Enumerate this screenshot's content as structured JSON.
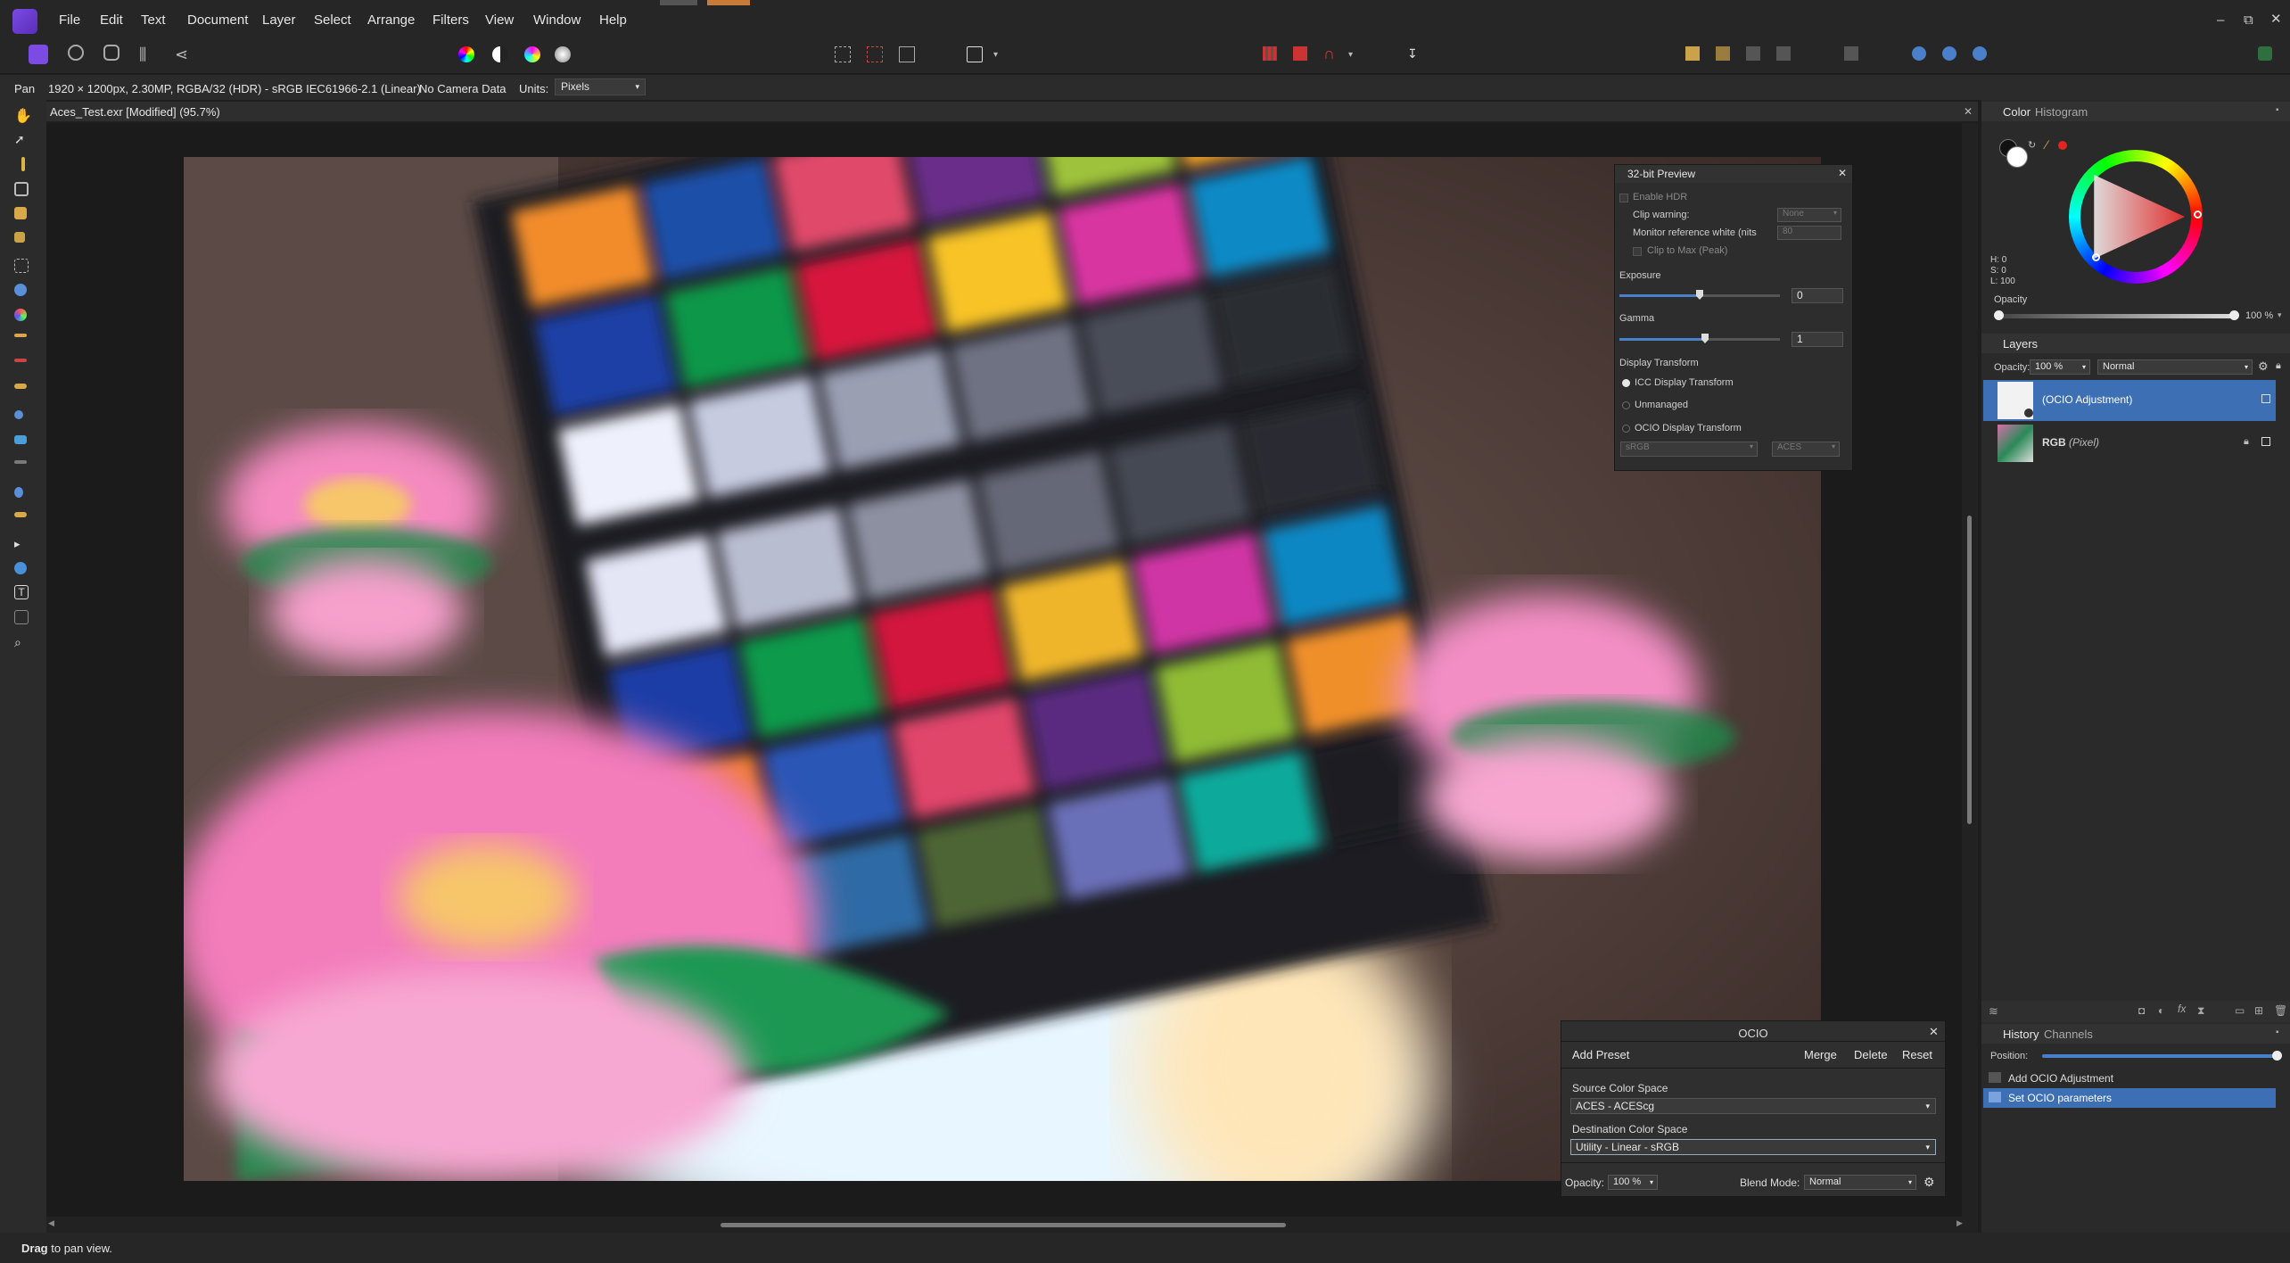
{
  "menu": {
    "items": [
      "File",
      "Edit",
      "Text",
      "Document",
      "Layer",
      "Select",
      "Arrange",
      "Filters",
      "View",
      "Window",
      "Help"
    ]
  },
  "context": {
    "tool": "Pan",
    "doc_info": "1920 × 1200px, 2.30MP, RGBA/32 (HDR) - sRGB IEC61966-2.1 (Linear)",
    "camera": "No Camera Data",
    "units_label": "Units:",
    "units_value": "Pixels"
  },
  "document": {
    "title": "Aces_Test.exr [Modified] (95.7%)"
  },
  "preview32": {
    "title": "32-bit Preview",
    "enable_hdr": "Enable HDR",
    "clip_warning": "Clip warning:",
    "clip_value": "None",
    "monitor_ref": "Monitor reference white (nits",
    "monitor_ref_value": "80",
    "clip_to_max": "Clip to Max (Peak)",
    "exposure_label": "Exposure",
    "exposure_value": "0",
    "gamma_label": "Gamma",
    "gamma_value": "1",
    "display_transform": "Display Transform",
    "options": [
      "ICC Display Transform",
      "Unmanaged",
      "OCIO Display Transform"
    ],
    "selected_option": "ICC Display Transform",
    "ocio_display": "sRGB",
    "ocio_view": "ACES"
  },
  "color_panel": {
    "tabs": [
      "Color",
      "Histogram"
    ],
    "h": "H: 0",
    "s": "S: 0",
    "l": "L: 100",
    "opacity_label": "Opacity",
    "opacity_value": "100 %"
  },
  "layers_panel": {
    "title": "Layers",
    "opacity_label": "Opacity:",
    "opacity_value": "100 %",
    "blend_mode": "Normal",
    "layers": [
      {
        "name": "(OCIO Adjustment)",
        "type": ""
      },
      {
        "name": "RGB",
        "type": "(Pixel)"
      }
    ]
  },
  "history_panel": {
    "tabs": [
      "History",
      "Channels"
    ],
    "position_label": "Position:",
    "items": [
      "Add OCIO Adjustment",
      "Set OCIO parameters"
    ],
    "selected": "Set OCIO parameters"
  },
  "ocio": {
    "title": "OCIO",
    "add_preset": "Add Preset",
    "merge": "Merge",
    "delete": "Delete",
    "reset": "Reset",
    "source_label": "Source Color Space",
    "source_value": "ACES - ACEScg",
    "dest_label": "Destination Color Space",
    "dest_value": "Utility - Linear - sRGB",
    "opacity_label": "Opacity:",
    "opacity_value": "100 %",
    "blend_label": "Blend Mode:",
    "blend_value": "Normal"
  },
  "status": {
    "bold": "Drag",
    "text": "to pan view."
  },
  "colors": {
    "accent": "#4a7fc9",
    "selected_row": "#3d6fb5",
    "affinity_purple": "#7b4be3"
  }
}
